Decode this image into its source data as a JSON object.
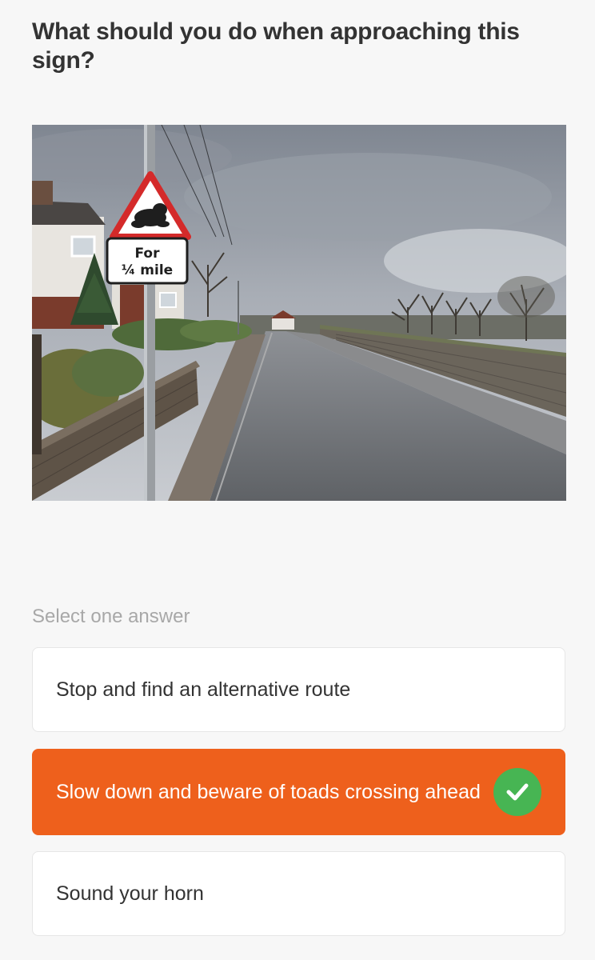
{
  "question": {
    "text": "What should you do when approaching this sign?"
  },
  "image": {
    "sign_plate_line1": "For",
    "sign_plate_line2": "¼ mile"
  },
  "prompt": "Select one answer",
  "answers": [
    {
      "label": "Stop and find an alternative route",
      "selected": false
    },
    {
      "label": "Slow down and beware of toads crossing ahead",
      "selected": true,
      "result_icon": "check-circle-icon"
    },
    {
      "label": "Sound your horn",
      "selected": false
    }
  ],
  "colors": {
    "accent": "#ee601c",
    "correct": "#47b553",
    "text": "#333333",
    "muted": "#a8a8a8",
    "background": "#f7f7f7"
  }
}
